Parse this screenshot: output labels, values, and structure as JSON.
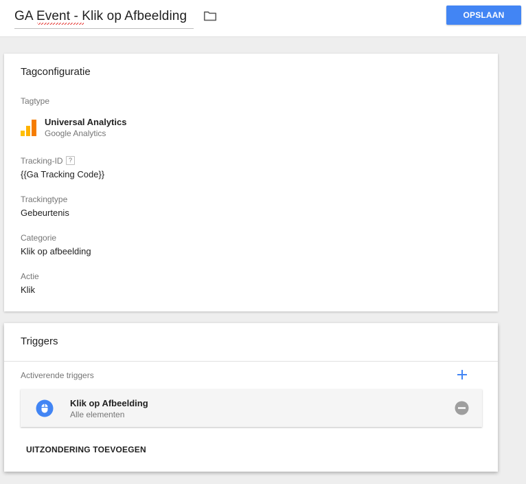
{
  "header": {
    "tag_name": "GA Event - Klik op Afbeelding",
    "folder_icon": "folder-icon",
    "save_label": "OPSLAAN"
  },
  "config": {
    "title": "Tagconfiguratie",
    "tagtype_label": "Tagtype",
    "tagtype_name": "Universal Analytics",
    "tagtype_provider": "Google Analytics",
    "tracking_id_label": "Tracking-ID",
    "help_glyph": "?",
    "tracking_id_value": "{{Ga Tracking Code}}",
    "trackingtype_label": "Trackingtype",
    "trackingtype_value": "Gebeurtenis",
    "categorie_label": "Categorie",
    "categorie_value": "Klik op afbeelding",
    "actie_label": "Actie",
    "actie_value": "Klik"
  },
  "triggers": {
    "title": "Triggers",
    "firing_label": "Activerende triggers",
    "items": [
      {
        "name": "Klik op Afbeelding",
        "sub": "Alle elementen",
        "icon": "mouse-icon"
      }
    ],
    "add_exception_label": "UITZONDERING TOEVOEGEN"
  },
  "colors": {
    "accent": "#4285f4",
    "ga_orange": "#f57c00",
    "ga_yellow": "#ffc107",
    "remove_grey": "#9e9e9e"
  }
}
